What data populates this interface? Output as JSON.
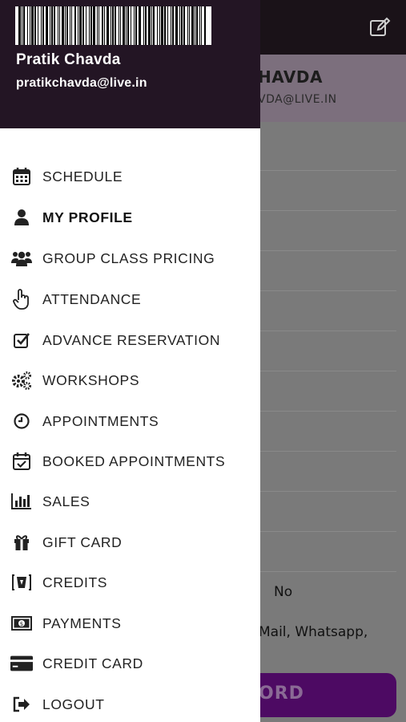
{
  "background": {
    "header_name": "HAVDA",
    "header_email": "VDA@LIVE.IN",
    "field_value_no": "No",
    "field_value_channels": "Mail, Whatsapp,",
    "button_label": "ORD"
  },
  "drawer": {
    "user_name": "Pratik Chavda",
    "user_email": "pratikchavda@live.in",
    "items": [
      {
        "label": "SCHEDULE",
        "icon": "calendar-icon"
      },
      {
        "label": "MY PROFILE",
        "icon": "user-icon",
        "active": true
      },
      {
        "label": "GROUP CLASS PRICING",
        "icon": "users-icon"
      },
      {
        "label": "ATTENDANCE",
        "icon": "hand-pointer-icon"
      },
      {
        "label": "ADVANCE RESERVATION",
        "icon": "check-square-icon"
      },
      {
        "label": "WORKSHOPS",
        "icon": "gears-icon"
      },
      {
        "label": "APPOINTMENTS",
        "icon": "clock-icon"
      },
      {
        "label": "BOOKED APPOINTMENTS",
        "icon": "calendar-check-icon"
      },
      {
        "label": "SALES",
        "icon": "bar-chart-icon"
      },
      {
        "label": "GIFT CARD",
        "icon": "gift-icon"
      },
      {
        "label": "CREDITS",
        "icon": "credits-icon"
      },
      {
        "label": "PAYMENTS",
        "icon": "money-icon"
      },
      {
        "label": "CREDIT CARD",
        "icon": "credit-card-icon"
      },
      {
        "label": "LOGOUT",
        "icon": "logout-icon"
      }
    ]
  },
  "colors": {
    "drawer_header": "#231524",
    "accent": "#4d0a63"
  }
}
